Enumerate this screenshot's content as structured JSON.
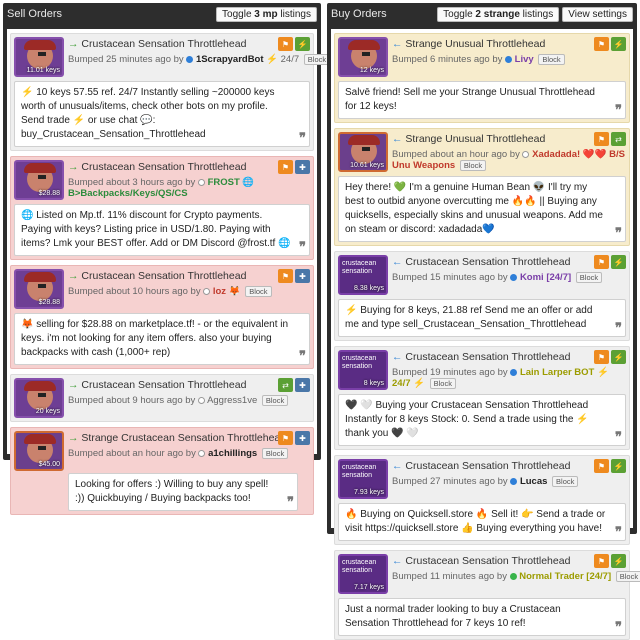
{
  "sell": {
    "title": "Sell Orders",
    "toggle_pre": "Toggle ",
    "toggle_bold": "3 mp",
    "toggle_post": " listings",
    "cards": [
      {
        "item": "Crustacean Sensation Throttlehead",
        "thumb_text": "",
        "thumb_price": "11.01 keys",
        "bumped": "Bumped 25 minutes ago by",
        "user": "1ScrapyardBot",
        "user_suffix": "⚡ 24/7",
        "block": "Block",
        "message": "⚡ 10 keys 57.55 ref. 24/7 Instantly selling ~200000 keys worth of unusuals/items, check other bots on my profile. Send trade ⚡ or use chat 💬: buy_Crustacean_Sensation_Throttlehead"
      },
      {
        "item": "Crustacean Sensation Throttlehead",
        "thumb_text": "",
        "thumb_price": "$28.88",
        "bumped": "Bumped about 3 hours ago by",
        "user": "FROST",
        "user_suffix": "🌐 B>Backpacks/Keys/QS/CS",
        "block": "Block",
        "message": "🌐 Listed on Mp.tf. 11% discount for Crypto payments. Paying with keys? Listing price in USD/1.80. Paying with items? Lmk your BEST offer. Add or DM Discord @frost.tf 🌐"
      },
      {
        "item": "Crustacean Sensation Throttlehead",
        "thumb_text": "",
        "thumb_price": "$28.88",
        "bumped": "Bumped about 10 hours ago by",
        "user": "loz",
        "user_suffix": "🦊",
        "block": "Block",
        "message": "🦊 selling for $28.88 on marketplace.tf! - or the equivalent in keys. i'm not looking for any item offers. also your buying backpacks with cash (1,000+ rep)"
      },
      {
        "item": "Crustacean Sensation Throttlehead",
        "thumb_text": "",
        "thumb_price": "20 keys",
        "bumped": "Bumped about 9 hours ago by",
        "user": "Aggress1ve",
        "user_suffix": "",
        "block": "Block",
        "message": ""
      },
      {
        "item": "Strange Crustacean Sensation Throttlehead",
        "thumb_text": "",
        "thumb_price": "$45.00",
        "bumped": "Bumped about an hour ago by",
        "user": "a1chillings",
        "user_suffix": "",
        "block": "Block",
        "message": "Looking for offers :) Willing to buy any spell! :)) Quickbuying / Buying backpacks too!"
      }
    ]
  },
  "buy": {
    "title": "Buy Orders",
    "toggle_pre": "Toggle ",
    "toggle_bold": "2 strange",
    "toggle_post": " listings",
    "view_settings": "View settings",
    "cards": [
      {
        "item": "Strange Unusual Throttlehead",
        "thumb_text": "",
        "thumb_price": "12 keys",
        "bumped": "Bumped 6 minutes ago by",
        "user": "Livy",
        "user_suffix": "",
        "block": "Block",
        "message": "Salvē friend! Sell me your Strange Unusual Throttlehead for 12 keys!"
      },
      {
        "item": "Strange Unusual Throttlehead",
        "thumb_text": "",
        "thumb_price": "10.61 keys",
        "bumped": "Bumped about an hour ago by",
        "user": "Xadadada!",
        "user_suffix": "❤️❤️ B/S Unu Weapons",
        "block": "Block",
        "message": "Hey there! 💚 I'm a genuine Human Bean 👽 I'll try my best to outbid anyone overcutting me 🔥🔥 || Buying any quicksells, especially skins and unusual weapons. Add me on steam or discord: xadadada💙"
      },
      {
        "item": "Crustacean Sensation Throttlehead",
        "thumb_text": "crustacean sensation",
        "thumb_price": "8.38 keys",
        "bumped": "Bumped 15 minutes ago by",
        "user": "Komi [24/7]",
        "user_suffix": "",
        "block": "Block",
        "message": "⚡ Buying for 8 keys, 21.88 ref Send me an offer or add me and type sell_Crustacean_Sensation_Throttlehead"
      },
      {
        "item": "Crustacean Sensation Throttlehead",
        "thumb_text": "crustacean sensation",
        "thumb_price": "8 keys",
        "bumped": "Bumped 19 minutes ago by",
        "user": "Lain Larper BOT",
        "user_suffix": "⚡ 24/7 ⚡",
        "block": "Block",
        "message": "🖤 🤍 Buying your Crustacean Sensation Throttlehead Instantly for 8 keys Stock: 0. Send a trade using the ⚡ thank you 🖤 🤍"
      },
      {
        "item": "Crustacean Sensation Throttlehead",
        "thumb_text": "crustacean sensation",
        "thumb_price": "7.93 keys",
        "bumped": "Bumped 27 minutes ago by",
        "user": "Lucas",
        "user_suffix": "",
        "block": "Block",
        "message": "🔥 Buying on Quicksell.store 🔥 Sell it! 👉 Send a trade or visit https://quicksell.store 👍 Buying everything you have!"
      },
      {
        "item": "Crustacean Sensation Throttlehead",
        "thumb_text": "crustacean sensation",
        "thumb_price": "7.17 keys",
        "bumped": "Bumped 11 minutes ago by",
        "user": "Normal Trader [24/7]",
        "user_suffix": "",
        "block": "Block",
        "message": "Just a normal trader looking to buy a Crustacean Sensation Throttlehead for 7 keys 10 ref!"
      }
    ]
  },
  "icons": {
    "arrow_sell": "→",
    "arrow_buy": "←",
    "quote": "❞",
    "flag": "⚑",
    "swap": "⇄",
    "user_add": "✚",
    "bolt": "⚡"
  },
  "colors": {
    "panel_bg": "#2d2d2d",
    "card_pink": "#f6d1d0",
    "card_tan": "#f7eccc",
    "orange": "#ee8a1f",
    "green": "#5ba034",
    "blue": "#4a77a8"
  }
}
